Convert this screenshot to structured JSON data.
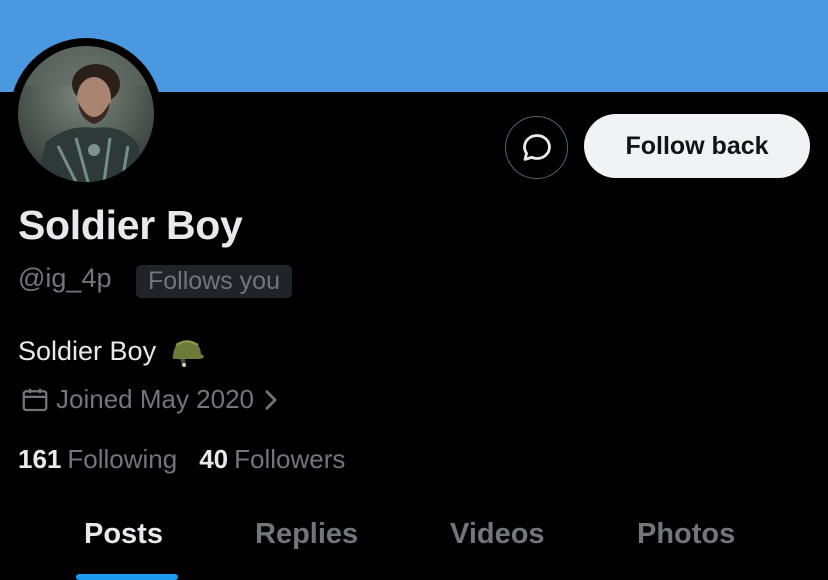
{
  "profile": {
    "display_name": "Soldier Boy",
    "handle": "@ig_4p",
    "follows_you_badge": "Follows you",
    "bio": "Soldier Boy",
    "bio_emoji": "military-helmet",
    "joined": "Joined May 2020"
  },
  "actions": {
    "message_icon": "message-bubble-icon",
    "follow_label": "Follow back"
  },
  "stats": {
    "following_count": "161",
    "following_label": "Following",
    "followers_count": "40",
    "followers_label": "Followers"
  },
  "tabs": [
    {
      "label": "Posts",
      "active": true
    },
    {
      "label": "Replies",
      "active": false
    },
    {
      "label": "Videos",
      "active": false
    },
    {
      "label": "Photos",
      "active": false
    }
  ],
  "colors": {
    "banner": "#4a98e0",
    "background": "#000000",
    "accent": "#1d9bf0",
    "secondary_text": "#71767b",
    "follow_button_bg": "#eff3f4"
  }
}
